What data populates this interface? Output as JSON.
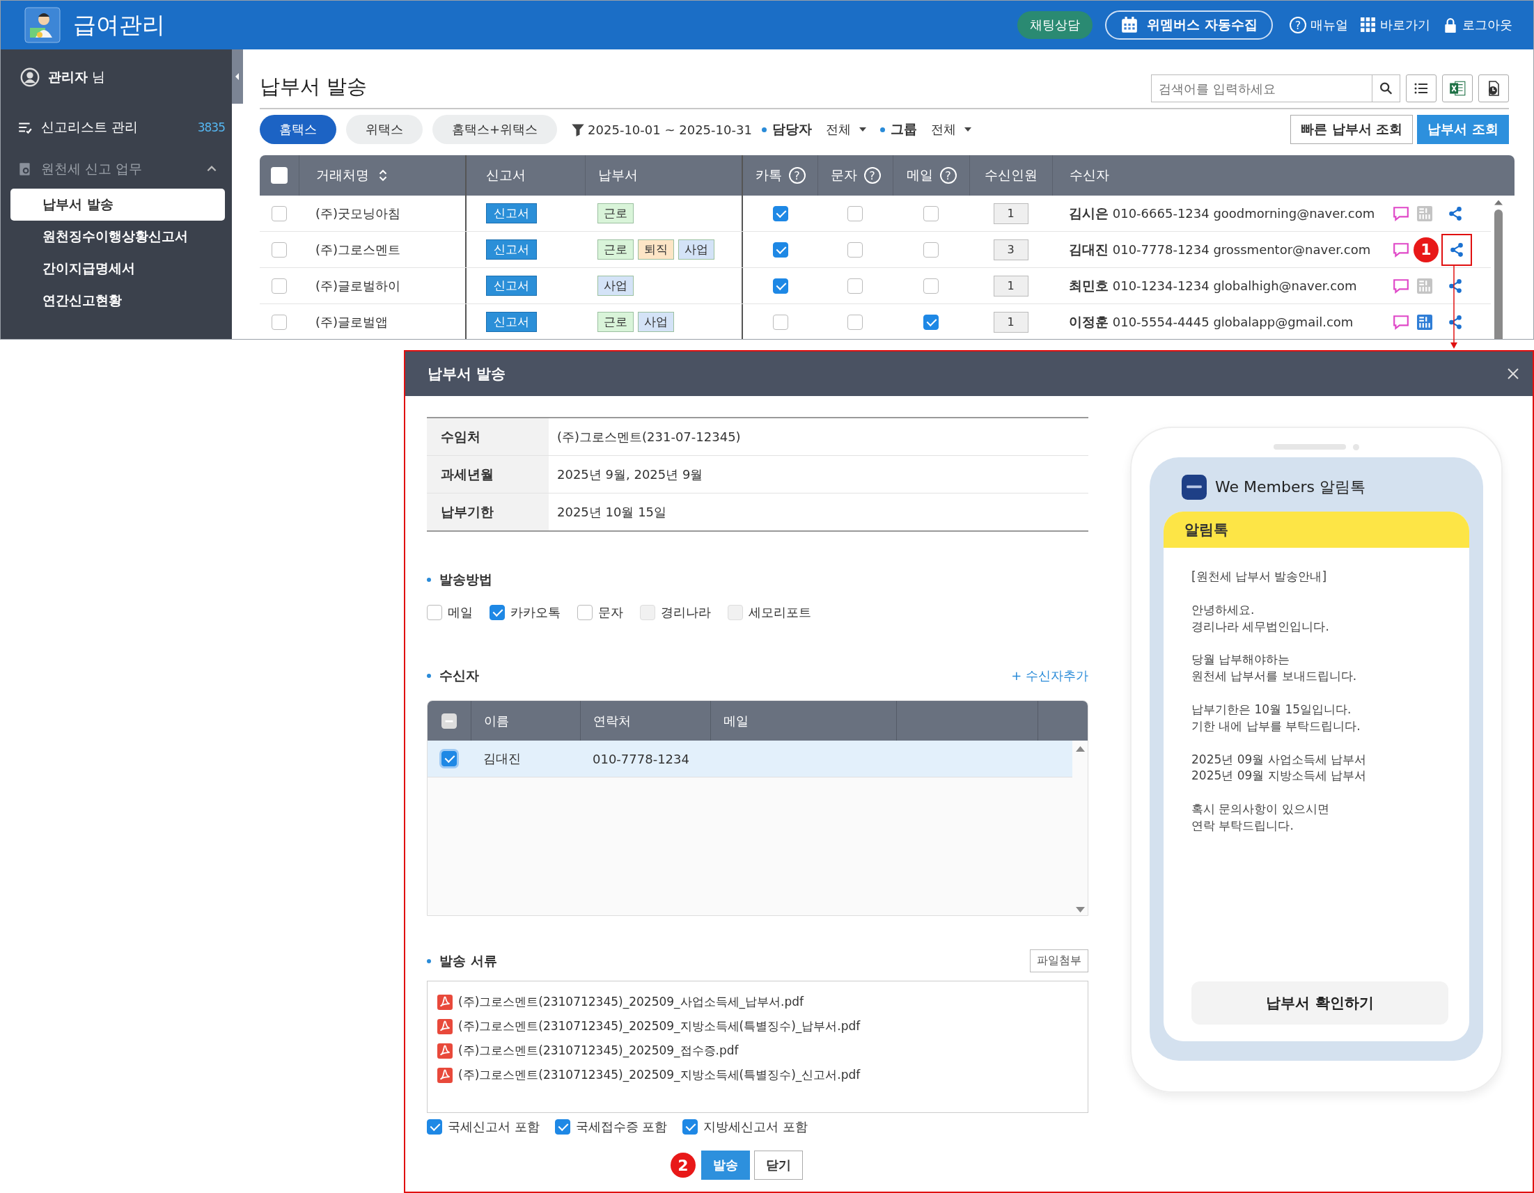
{
  "header": {
    "title": "급여관리",
    "chat_button": "채팅상담",
    "collect_button": "위멤버스 자동수집",
    "links": [
      {
        "kind": "help",
        "label": "매뉴얼",
        "icon_text": "?"
      },
      {
        "kind": "grid",
        "label": "바로가기"
      },
      {
        "kind": "lock",
        "label": "로그아웃"
      }
    ]
  },
  "sidebar": {
    "user": "관리자",
    "user_suffix": "님",
    "items": [
      {
        "kind": "list",
        "label": "신고리스트 관리",
        "count": "3835"
      },
      {
        "kind": "group",
        "label": "원천세 신고 업무",
        "expanded": true,
        "children": [
          {
            "label": "납부서 발송",
            "selected": true
          },
          {
            "label": "원천징수이행상황신고서",
            "selected": false
          },
          {
            "label": "간이지급명세서",
            "selected": false
          },
          {
            "label": "연간신고현황",
            "selected": false
          }
        ]
      }
    ]
  },
  "page": {
    "title": "납부서 발송",
    "search": {
      "placeholder": "검색어를 입력하세요"
    },
    "tabs": [
      {
        "label": "홈택스",
        "selected": true
      },
      {
        "label": "위택스",
        "selected": false
      },
      {
        "label": "홈택스+위택스",
        "selected": false
      }
    ],
    "date_range": "2025-10-01 ~ 2025-10-31",
    "filters": [
      {
        "label": "담당자",
        "value": "전체"
      },
      {
        "label": "그룹",
        "value": "전체"
      }
    ],
    "buttons": [
      {
        "label": "빠른 납부서 조회",
        "primary": false
      },
      {
        "label": "납부서 조회",
        "primary": true
      }
    ]
  },
  "table": {
    "select_all_checked": false,
    "columns": [
      {
        "label": "거래처명",
        "sortable": true
      },
      {
        "label": "신고서"
      },
      {
        "label": "납부서"
      },
      {
        "label": "카톡",
        "help": "?"
      },
      {
        "label": "문자",
        "help": "?"
      },
      {
        "label": "메일",
        "help": "?"
      },
      {
        "label": "수신인원"
      },
      {
        "label": "수신자"
      }
    ],
    "rows": [
      {
        "checked": false,
        "name": "(주)굿모닝아침",
        "report": "신고서",
        "payments": [
          {
            "label": "근로",
            "color": "#d9f4d9"
          }
        ],
        "kakao": true,
        "sms": false,
        "mail": false,
        "count": "1",
        "recipient": "김시은",
        "phone": "010-6665-1234",
        "email": "goodmorning@naver.com",
        "erp_linked": false,
        "highlighted": false
      },
      {
        "checked": false,
        "name": "(주)그로스멘트",
        "report": "신고서",
        "payments": [
          {
            "label": "근로",
            "color": "#d9f4d9"
          },
          {
            "label": "퇴직",
            "color": "#fde5c6"
          },
          {
            "label": "사업",
            "color": "#d4e3f7"
          }
        ],
        "kakao": true,
        "sms": false,
        "mail": false,
        "count": "3",
        "recipient": "김대진",
        "phone": "010-7778-1234",
        "email": "grossmentor@naver.com",
        "highlighted": true,
        "marker": "1"
      },
      {
        "checked": false,
        "name": "(주)글로벌하이",
        "report": "신고서",
        "payments": [
          {
            "label": "사업",
            "color": "#d4e3f7"
          }
        ],
        "kakao": true,
        "sms": false,
        "mail": false,
        "count": "1",
        "recipient": "최민호",
        "phone": "010-1234-1234",
        "email": "globalhigh@naver.com",
        "erp_linked": false,
        "highlighted": false
      },
      {
        "checked": false,
        "name": "(주)글로벌앱",
        "report": "신고서",
        "payments": [
          {
            "label": "근로",
            "color": "#d9f4d9"
          },
          {
            "label": "사업",
            "color": "#d4e3f7"
          }
        ],
        "kakao": false,
        "sms": false,
        "mail": true,
        "count": "1",
        "recipient": "이정훈",
        "phone": "010-5554-4445",
        "email": "globalapp@gmail.com",
        "erp_linked": true,
        "highlighted": false
      }
    ]
  },
  "modal": {
    "title": "납부서 발송",
    "info": [
      {
        "label": "수임처",
        "value": "(주)그로스멘트(231-07-12345)"
      },
      {
        "label": "과세년월",
        "value": "2025년 9월, 2025년 9월"
      },
      {
        "label": "납부기한",
        "value": "2025년 10월 15일"
      }
    ],
    "method": {
      "title": "발송방법",
      "options": [
        {
          "label": "메일",
          "checked": false,
          "disabled": false
        },
        {
          "label": "카카오톡",
          "checked": true,
          "disabled": false
        },
        {
          "label": "문자",
          "checked": false,
          "disabled": false
        },
        {
          "label": "경리나라",
          "checked": false,
          "disabled": true
        },
        {
          "label": "세모리포트",
          "checked": false,
          "disabled": true
        }
      ]
    },
    "recipients": {
      "title": "수신자",
      "add_link": "+ 수신자추가",
      "select_all_partial": true,
      "columns": [
        "이름",
        "연락처",
        "메일"
      ],
      "rows": [
        {
          "name": "김대진",
          "phone": "010-7778-1234",
          "selected": true
        }
      ]
    },
    "documents": {
      "title": "발송 서류",
      "attach_button": "파일첨부",
      "files": [
        "(주)그로스멘트(2310712345)_202509_사업소득세_납부서.pdf",
        "(주)그로스멘트(2310712345)_202509_지방소득세(특별징수)_납부서.pdf",
        "(주)그로스멘트(2310712345)_202509_접수증.pdf",
        "(주)그로스멘트(2310712345)_202509_지방소득세(특별징수)_신고서.pdf"
      ],
      "includes": [
        {
          "label": "국세신고서 포함",
          "checked": true
        },
        {
          "label": "국세접수증 포함",
          "checked": true
        },
        {
          "label": "지방세신고서 포함",
          "checked": true
        }
      ]
    },
    "marker": "2",
    "buttons": [
      {
        "label": "발송",
        "primary": true
      },
      {
        "label": "닫기",
        "primary": false
      }
    ]
  },
  "phone_preview": {
    "app_name": "We Members 알림톡",
    "bubble_title": "알림톡",
    "paragraphs": [
      "[원천세 납부서 발송안내]",
      "안녕하세요.\n경리나라 세무법인입니다.",
      "당월 납부해야하는\n원천세 납부서를 보내드립니다.",
      "납부기한은 10월 15일입니다.\n기한 내에 납부를 부탁드립니다.",
      "2025년 09월 사업소득세 납부서\n2025년 09월 지방소득세 납부서",
      "혹시 문의사항이 있으시면\n연락 부탁드립니다."
    ],
    "button": "납부서 확인하기"
  }
}
